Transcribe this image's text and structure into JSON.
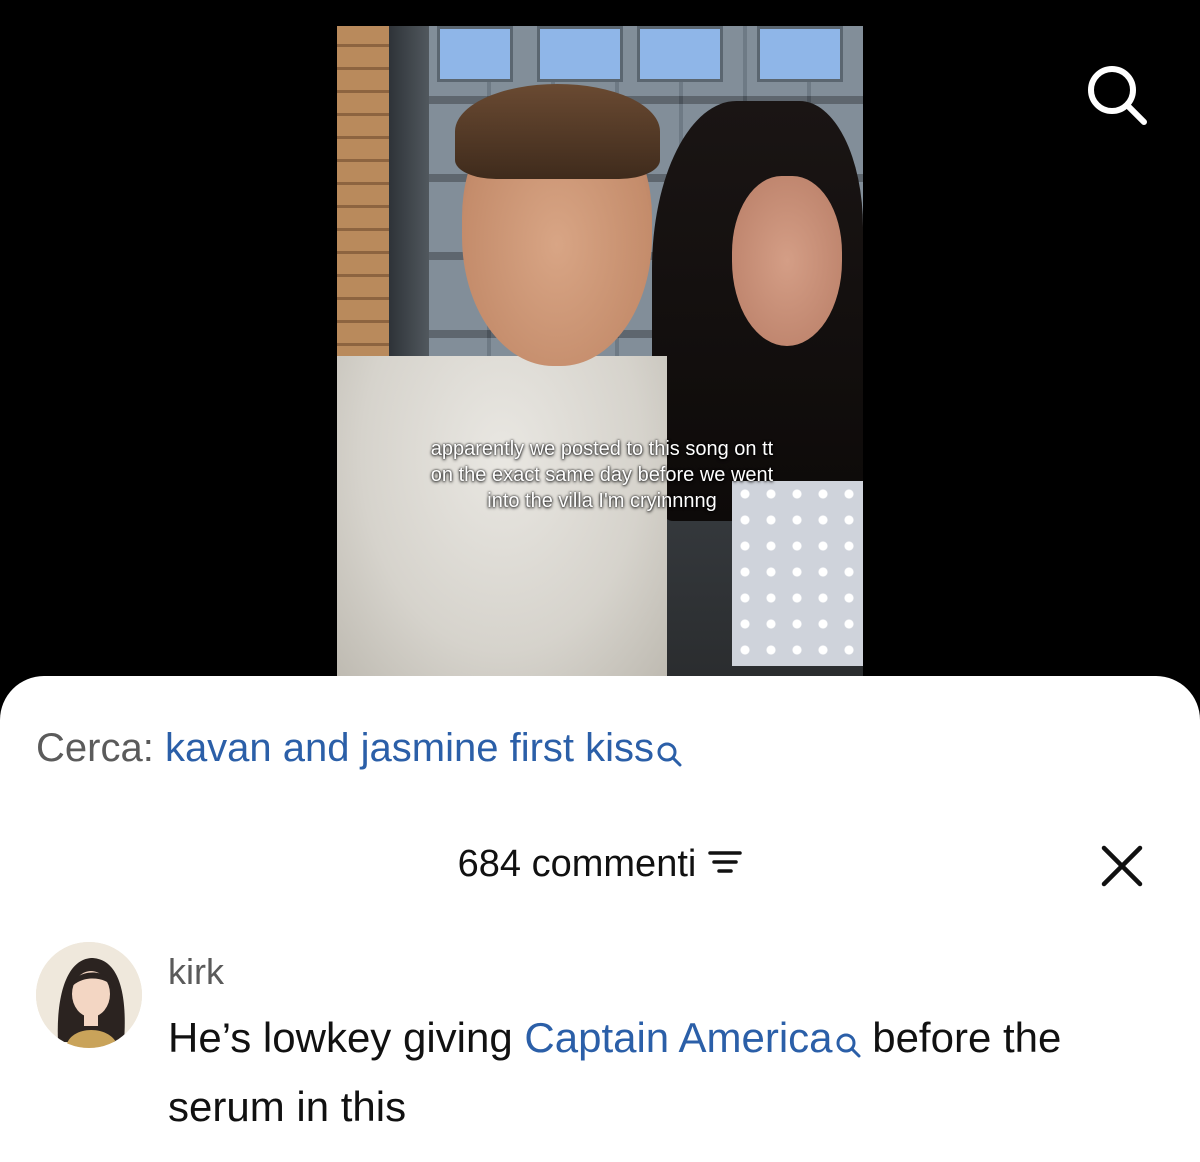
{
  "video": {
    "caption": "apparently we posted to this song on tt on the exact same day before we went into the villa I'm cryinnnng"
  },
  "top_bar": {
    "search_icon": "search-icon"
  },
  "search_suggestion": {
    "prefix": "Cerca:",
    "query": "kavan and jasmine first kiss",
    "icon": "search-icon"
  },
  "comments": {
    "count_label": "684 commenti",
    "filter_icon": "filter-icon",
    "close_icon": "close-icon",
    "items": [
      {
        "username": "kirk",
        "text_before": "He’s lowkey giving ",
        "link_text": "Captain America",
        "text_after": " before the serum in this"
      }
    ]
  },
  "colors": {
    "link": "#2b5fa8",
    "muted_text": "#5b5b5b",
    "sheet_background": "#ffffff",
    "background": "#000000"
  }
}
